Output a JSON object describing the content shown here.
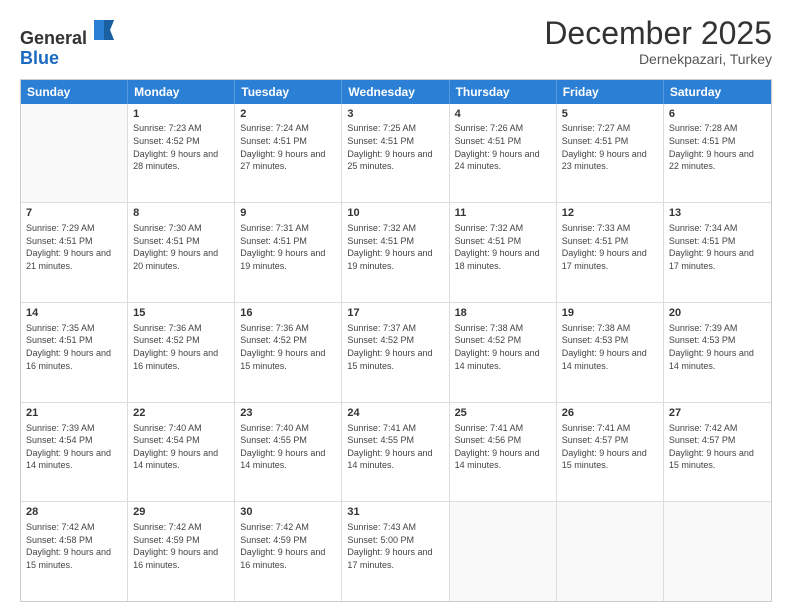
{
  "header": {
    "logo_general": "General",
    "logo_blue": "Blue",
    "month_title": "December 2025",
    "location": "Dernekpazari, Turkey"
  },
  "weekdays": [
    "Sunday",
    "Monday",
    "Tuesday",
    "Wednesday",
    "Thursday",
    "Friday",
    "Saturday"
  ],
  "weeks": [
    [
      {
        "day": "",
        "sunrise": "",
        "sunset": "",
        "daylight": ""
      },
      {
        "day": "1",
        "sunrise": "Sunrise: 7:23 AM",
        "sunset": "Sunset: 4:52 PM",
        "daylight": "Daylight: 9 hours and 28 minutes."
      },
      {
        "day": "2",
        "sunrise": "Sunrise: 7:24 AM",
        "sunset": "Sunset: 4:51 PM",
        "daylight": "Daylight: 9 hours and 27 minutes."
      },
      {
        "day": "3",
        "sunrise": "Sunrise: 7:25 AM",
        "sunset": "Sunset: 4:51 PM",
        "daylight": "Daylight: 9 hours and 25 minutes."
      },
      {
        "day": "4",
        "sunrise": "Sunrise: 7:26 AM",
        "sunset": "Sunset: 4:51 PM",
        "daylight": "Daylight: 9 hours and 24 minutes."
      },
      {
        "day": "5",
        "sunrise": "Sunrise: 7:27 AM",
        "sunset": "Sunset: 4:51 PM",
        "daylight": "Daylight: 9 hours and 23 minutes."
      },
      {
        "day": "6",
        "sunrise": "Sunrise: 7:28 AM",
        "sunset": "Sunset: 4:51 PM",
        "daylight": "Daylight: 9 hours and 22 minutes."
      }
    ],
    [
      {
        "day": "7",
        "sunrise": "Sunrise: 7:29 AM",
        "sunset": "Sunset: 4:51 PM",
        "daylight": "Daylight: 9 hours and 21 minutes."
      },
      {
        "day": "8",
        "sunrise": "Sunrise: 7:30 AM",
        "sunset": "Sunset: 4:51 PM",
        "daylight": "Daylight: 9 hours and 20 minutes."
      },
      {
        "day": "9",
        "sunrise": "Sunrise: 7:31 AM",
        "sunset": "Sunset: 4:51 PM",
        "daylight": "Daylight: 9 hours and 19 minutes."
      },
      {
        "day": "10",
        "sunrise": "Sunrise: 7:32 AM",
        "sunset": "Sunset: 4:51 PM",
        "daylight": "Daylight: 9 hours and 19 minutes."
      },
      {
        "day": "11",
        "sunrise": "Sunrise: 7:32 AM",
        "sunset": "Sunset: 4:51 PM",
        "daylight": "Daylight: 9 hours and 18 minutes."
      },
      {
        "day": "12",
        "sunrise": "Sunrise: 7:33 AM",
        "sunset": "Sunset: 4:51 PM",
        "daylight": "Daylight: 9 hours and 17 minutes."
      },
      {
        "day": "13",
        "sunrise": "Sunrise: 7:34 AM",
        "sunset": "Sunset: 4:51 PM",
        "daylight": "Daylight: 9 hours and 17 minutes."
      }
    ],
    [
      {
        "day": "14",
        "sunrise": "Sunrise: 7:35 AM",
        "sunset": "Sunset: 4:51 PM",
        "daylight": "Daylight: 9 hours and 16 minutes."
      },
      {
        "day": "15",
        "sunrise": "Sunrise: 7:36 AM",
        "sunset": "Sunset: 4:52 PM",
        "daylight": "Daylight: 9 hours and 16 minutes."
      },
      {
        "day": "16",
        "sunrise": "Sunrise: 7:36 AM",
        "sunset": "Sunset: 4:52 PM",
        "daylight": "Daylight: 9 hours and 15 minutes."
      },
      {
        "day": "17",
        "sunrise": "Sunrise: 7:37 AM",
        "sunset": "Sunset: 4:52 PM",
        "daylight": "Daylight: 9 hours and 15 minutes."
      },
      {
        "day": "18",
        "sunrise": "Sunrise: 7:38 AM",
        "sunset": "Sunset: 4:52 PM",
        "daylight": "Daylight: 9 hours and 14 minutes."
      },
      {
        "day": "19",
        "sunrise": "Sunrise: 7:38 AM",
        "sunset": "Sunset: 4:53 PM",
        "daylight": "Daylight: 9 hours and 14 minutes."
      },
      {
        "day": "20",
        "sunrise": "Sunrise: 7:39 AM",
        "sunset": "Sunset: 4:53 PM",
        "daylight": "Daylight: 9 hours and 14 minutes."
      }
    ],
    [
      {
        "day": "21",
        "sunrise": "Sunrise: 7:39 AM",
        "sunset": "Sunset: 4:54 PM",
        "daylight": "Daylight: 9 hours and 14 minutes."
      },
      {
        "day": "22",
        "sunrise": "Sunrise: 7:40 AM",
        "sunset": "Sunset: 4:54 PM",
        "daylight": "Daylight: 9 hours and 14 minutes."
      },
      {
        "day": "23",
        "sunrise": "Sunrise: 7:40 AM",
        "sunset": "Sunset: 4:55 PM",
        "daylight": "Daylight: 9 hours and 14 minutes."
      },
      {
        "day": "24",
        "sunrise": "Sunrise: 7:41 AM",
        "sunset": "Sunset: 4:55 PM",
        "daylight": "Daylight: 9 hours and 14 minutes."
      },
      {
        "day": "25",
        "sunrise": "Sunrise: 7:41 AM",
        "sunset": "Sunset: 4:56 PM",
        "daylight": "Daylight: 9 hours and 14 minutes."
      },
      {
        "day": "26",
        "sunrise": "Sunrise: 7:41 AM",
        "sunset": "Sunset: 4:57 PM",
        "daylight": "Daylight: 9 hours and 15 minutes."
      },
      {
        "day": "27",
        "sunrise": "Sunrise: 7:42 AM",
        "sunset": "Sunset: 4:57 PM",
        "daylight": "Daylight: 9 hours and 15 minutes."
      }
    ],
    [
      {
        "day": "28",
        "sunrise": "Sunrise: 7:42 AM",
        "sunset": "Sunset: 4:58 PM",
        "daylight": "Daylight: 9 hours and 15 minutes."
      },
      {
        "day": "29",
        "sunrise": "Sunrise: 7:42 AM",
        "sunset": "Sunset: 4:59 PM",
        "daylight": "Daylight: 9 hours and 16 minutes."
      },
      {
        "day": "30",
        "sunrise": "Sunrise: 7:42 AM",
        "sunset": "Sunset: 4:59 PM",
        "daylight": "Daylight: 9 hours and 16 minutes."
      },
      {
        "day": "31",
        "sunrise": "Sunrise: 7:43 AM",
        "sunset": "Sunset: 5:00 PM",
        "daylight": "Daylight: 9 hours and 17 minutes."
      },
      {
        "day": "",
        "sunrise": "",
        "sunset": "",
        "daylight": ""
      },
      {
        "day": "",
        "sunrise": "",
        "sunset": "",
        "daylight": ""
      },
      {
        "day": "",
        "sunrise": "",
        "sunset": "",
        "daylight": ""
      }
    ]
  ]
}
